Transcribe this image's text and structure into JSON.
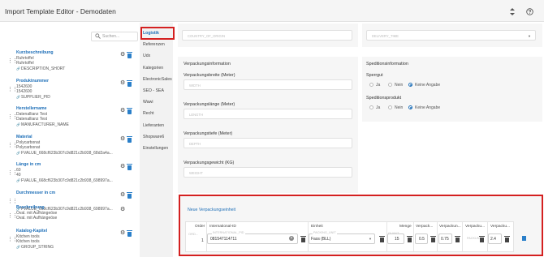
{
  "header": {
    "title": "Import Template Editor - Demodaten",
    "sort_icon": "sort-icon",
    "help_icon": "help-icon"
  },
  "search": {
    "placeholder": "Suchen..."
  },
  "fields": [
    {
      "name": "Kurzbeschreibung",
      "values": [
        "Ruhrtoffel",
        "Ruhrtoffel"
      ],
      "key": "DESCRIPTION_SHORT",
      "gear": true,
      "trash": true
    },
    {
      "name": "Produktnummer",
      "values": [
        "1542600",
        "1542600"
      ],
      "key": "SUPPLIER_PID",
      "gear": true,
      "trash": true
    },
    {
      "name": "Herstellername",
      "values": [
        "Datenallianz Test",
        "Datenallianz Test"
      ],
      "key": "MANUFACTURER_NAME",
      "gear": true,
      "trash": true
    },
    {
      "name": "Material",
      "values": [
        "Polycarbonat",
        "Polycarbonat"
      ],
      "key": "FVALUE_668cf623b307c9d821c2b938_68d2a4a...",
      "gear": true,
      "trash": true
    },
    {
      "name": "Länge in cm",
      "values": [
        "60",
        "40"
      ],
      "key": "FVALUE_668cf623b307c9d821c2b938_698997a...",
      "gear": true,
      "trash": true
    },
    {
      "name": "Durchmesser in cm",
      "values": [
        "",
        ""
      ],
      "key": "FVALUE_668cf623b307c9d821c2b938_698997a...",
      "gear": true,
      "trash": true
    },
    {
      "name": "Beschreibung",
      "values": [
        "Oval. mit Aufhängeöse",
        "Oval. mit Aufhängeöse"
      ],
      "key": "",
      "gear": true,
      "trash": false
    },
    {
      "name": "Katalog-Kapitel",
      "values": [
        "Kitchen tools",
        "Kitchen tools"
      ],
      "key": "GROUP_STRING",
      "gear": true,
      "trash": true
    }
  ],
  "tabs": [
    "Logistik",
    "Referenzen",
    "Udx",
    "Kategorien",
    "ElectronicSales",
    "SEO - SEA",
    "Wawi",
    "Recht",
    "Lieferanten",
    "Shopware6",
    "Einstellungen"
  ],
  "top_fields": {
    "country_placeholder": "COUNTRY_OF_ORIGIN",
    "delivery_placeholder": "DELIVERY_TIME"
  },
  "packaging": {
    "title": "Verpackungsinformation",
    "fields": [
      {
        "label": "Verpackungsbreite (Meter)",
        "placeholder": "WIDTH"
      },
      {
        "label": "Verpackungslänge (Meter)",
        "placeholder": "LENGTH"
      },
      {
        "label": "Verpackungstiefe (Meter)",
        "placeholder": "DEPTH"
      },
      {
        "label": "Verpackungsgewicht (KG)",
        "placeholder": "WEIGHT"
      }
    ]
  },
  "shipping": {
    "title": "Speditionsinformation",
    "groups": [
      {
        "label": "Sperrgut",
        "options": [
          "Ja",
          "Nein",
          "Keine Angabe"
        ],
        "selected": 2
      },
      {
        "label": "Speditionsprodukt",
        "options": [
          "Ja",
          "Nein",
          "Keine Angabe"
        ],
        "selected": 2
      }
    ]
  },
  "packaging_units": {
    "new_link": "Neue Verpackungseinheit",
    "headers": [
      "Order",
      "International-ID",
      "Einheit",
      "Menge",
      "Verpack...",
      "Verpackun...",
      "Verpacku...",
      "Verpacku..."
    ],
    "row": {
      "order_ph": "ORD...",
      "order": "1",
      "intl_ph": "INTERNATIONAL_PID",
      "intl": "081547114711",
      "unit_ph": "PACKING_UNIT",
      "unit": "Fass (BLL)",
      "qty_ph": "QUANT...",
      "qty": "15",
      "c1": "0.5",
      "c2": "0.75",
      "c3_ph": "PACKUN...",
      "c4": "2.4"
    }
  },
  "colors": {
    "accent": "#1e6fb8",
    "highlight": "#d42020"
  }
}
